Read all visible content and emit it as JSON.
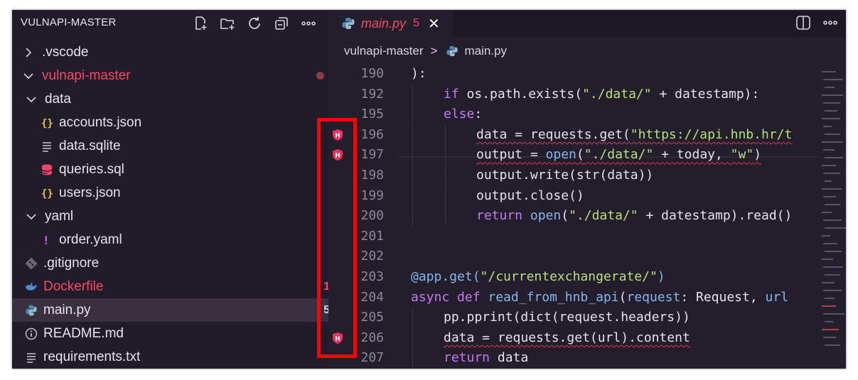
{
  "explorer": {
    "title": "VULNAPI-MASTER",
    "actions": [
      "new-file-icon",
      "new-folder-icon",
      "refresh-icon",
      "collapse-all-icon",
      "more-icon"
    ],
    "items": [
      {
        "label": ".vscode",
        "icon": "chevron-right-icon",
        "kind": "folder",
        "depth": 0
      },
      {
        "label": "vulnapi-master",
        "icon": "chevron-down-icon",
        "kind": "folder",
        "depth": 0,
        "status": "modified-dot"
      },
      {
        "label": "data",
        "icon": "chevron-down-icon",
        "kind": "folder",
        "depth": 1
      },
      {
        "label": "accounts.json",
        "icon": "json-icon",
        "kind": "file",
        "depth": 2
      },
      {
        "label": "data.sqlite",
        "icon": "text-file-icon",
        "kind": "file",
        "depth": 2
      },
      {
        "label": "queries.sql",
        "icon": "database-icon",
        "kind": "file",
        "depth": 2
      },
      {
        "label": "users.json",
        "icon": "json-icon",
        "kind": "file",
        "depth": 2
      },
      {
        "label": "yaml",
        "icon": "chevron-down-icon",
        "kind": "folder",
        "depth": 1
      },
      {
        "label": "order.yaml",
        "icon": "yaml-icon",
        "kind": "file",
        "depth": 2
      },
      {
        "label": ".gitignore",
        "icon": "git-icon",
        "kind": "file",
        "depth": 1
      },
      {
        "label": "Dockerfile",
        "icon": "docker-icon",
        "kind": "file",
        "depth": 1,
        "badge": "1"
      },
      {
        "label": "main.py",
        "icon": "python-icon",
        "kind": "file",
        "depth": 1,
        "badge": "5",
        "selected": true
      },
      {
        "label": "README.md",
        "icon": "info-icon",
        "kind": "file",
        "depth": 1
      },
      {
        "label": "requirements.txt",
        "icon": "text-file-icon",
        "kind": "file",
        "depth": 1
      }
    ]
  },
  "editor": {
    "tab": {
      "label": "main.py",
      "problems": "5",
      "close": "✕"
    },
    "breadcrumb": {
      "folder": "vulnapi-master",
      "separator": ">",
      "file": "main.py"
    },
    "lines": [
      {
        "n": "190",
        "indent": 0,
        "tokens": [
          [
            "plain",
            "):"
          ]
        ]
      },
      {
        "n": "192",
        "indent": 1,
        "tokens": [
          [
            "kw",
            "if "
          ],
          [
            "plain",
            "os.path.exists("
          ],
          [
            "str",
            "\"./data/\""
          ],
          [
            "plain",
            " + datestamp):"
          ]
        ]
      },
      {
        "n": "195",
        "indent": 1,
        "tokens": [
          [
            "kw",
            "else"
          ],
          [
            "plain",
            ":"
          ]
        ]
      },
      {
        "n": "196",
        "indent": 2,
        "marker": true,
        "tokens": [
          [
            "err",
            "data = requests.get("
          ],
          [
            "str err",
            "\"https://api.hnb.hr/t"
          ]
        ]
      },
      {
        "n": "197",
        "indent": 2,
        "marker": true,
        "tokens": [
          [
            "err",
            "output = "
          ],
          [
            "fn err",
            "open"
          ],
          [
            "err",
            "("
          ],
          [
            "str err",
            "\"./data/\""
          ],
          [
            "err",
            " + today, "
          ],
          [
            "str err",
            "\"w\""
          ],
          [
            "err",
            ")"
          ]
        ]
      },
      {
        "n": "198",
        "indent": 2,
        "tokens": [
          [
            "plain",
            "output.write(str(data))"
          ]
        ]
      },
      {
        "n": "199",
        "indent": 2,
        "tokens": [
          [
            "plain",
            "output.close()"
          ]
        ]
      },
      {
        "n": "200",
        "indent": 2,
        "tokens": [
          [
            "kw",
            "return "
          ],
          [
            "fn",
            "open"
          ],
          [
            "plain",
            "("
          ],
          [
            "str",
            "\"./data/\""
          ],
          [
            "plain",
            " + datestamp).read()"
          ]
        ]
      },
      {
        "n": "201",
        "indent": 0,
        "tokens": []
      },
      {
        "n": "202",
        "indent": 0,
        "tokens": []
      },
      {
        "n": "203",
        "indent": 0,
        "tokens": [
          [
            "deco",
            "@app.get("
          ],
          [
            "str",
            "\"/currentexchangerate/\""
          ],
          [
            "deco",
            ")"
          ]
        ]
      },
      {
        "n": "204",
        "indent": 0,
        "tokens": [
          [
            "kw",
            "async def "
          ],
          [
            "fn",
            "read_from_hnb_api"
          ],
          [
            "plain",
            "("
          ],
          [
            "fn",
            "request"
          ],
          [
            "plain",
            ": Request, "
          ],
          [
            "fn",
            "url"
          ]
        ]
      },
      {
        "n": "205",
        "indent": 1,
        "tokens": [
          [
            "plain",
            "pp.pprint(dict(request.headers))"
          ]
        ]
      },
      {
        "n": "206",
        "indent": 1,
        "marker": true,
        "tokens": [
          [
            "err",
            "data = requests.get(url).content"
          ]
        ]
      },
      {
        "n": "207",
        "indent": 1,
        "tokens": [
          [
            "kw",
            "return "
          ],
          [
            "plain",
            "data"
          ]
        ]
      }
    ]
  },
  "colors": {
    "accent_red": "#f24b67",
    "annotation_box": "#ff0000"
  }
}
